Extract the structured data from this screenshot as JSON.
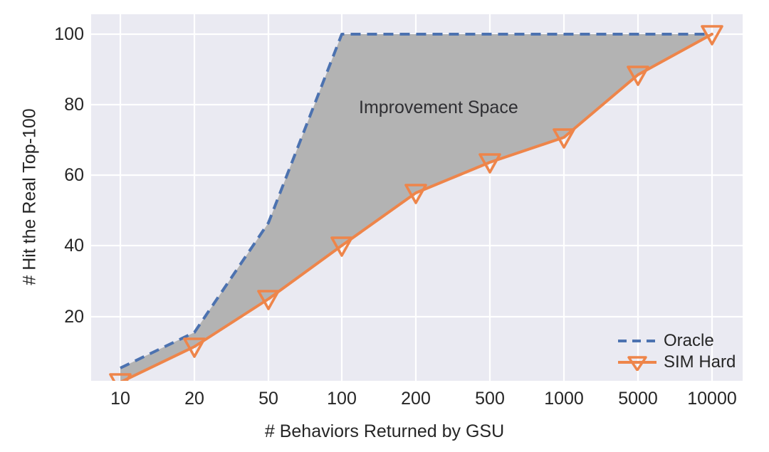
{
  "chart_data": {
    "type": "line",
    "title": "",
    "xlabel": "# Behaviors Returned by GSU",
    "ylabel": "# Hit the Real Top-100",
    "categories": [
      "10",
      "20",
      "50",
      "100",
      "200",
      "500",
      "1000",
      "5000",
      "10000"
    ],
    "xtick_labels": [
      "10",
      "20",
      "50",
      "100",
      "200",
      "500",
      "1000",
      "5000",
      "10000"
    ],
    "ytick_labels": [
      "20",
      "40",
      "60",
      "80",
      "100"
    ],
    "yticks": [
      20,
      40,
      60,
      80,
      100
    ],
    "ylim": [
      4,
      104
    ],
    "grid": true,
    "legend_position": "lower right",
    "series": [
      {
        "name": "Oracle",
        "color": "#4c72b0",
        "linestyle": "dashed",
        "marker": "none",
        "values": [
          10,
          20,
          51,
          100,
          100,
          100,
          100,
          100,
          100
        ]
      },
      {
        "name": "SIM Hard",
        "color": "#ee854a",
        "linestyle": "solid",
        "marker": "triangle-down",
        "values": [
          6,
          11.5,
          25,
          40.5,
          55.5,
          64,
          71,
          88.5,
          100
        ]
      }
    ],
    "annotations": [
      {
        "text": "Improvement Space",
        "x_category": "100",
        "y_value": 81,
        "color": "#2f2f33"
      }
    ],
    "fill_between": {
      "label": "Improvement Space",
      "upper_series": "Oracle",
      "lower_series": "SIM Hard",
      "color": "#b3b3b3",
      "opacity": 1
    },
    "colors": {
      "panel_background": "#eaeaf2",
      "figure_background": "#ffffff",
      "gridline": "#ffffff",
      "tick_text": "#262626",
      "oracle": "#4c72b0",
      "sim_hard": "#ee854a",
      "improvement_fill": "#b3b3b3"
    }
  },
  "legend": {
    "items": [
      {
        "label": "Oracle",
        "color": "#4c72b0",
        "style": "dashed",
        "marker": "none"
      },
      {
        "label": "SIM Hard",
        "color": "#ee854a",
        "style": "solid",
        "marker": "triangle-down"
      }
    ]
  },
  "axes": {
    "y_label": "# Hit the Real Top-100",
    "x_label": "# Behaviors Returned by GSU",
    "y_ticks": [
      "100",
      "80",
      "60",
      "40",
      "20"
    ],
    "x_ticks": [
      "10",
      "20",
      "50",
      "100",
      "200",
      "500",
      "1000",
      "5000",
      "10000"
    ]
  },
  "annotation": {
    "improvement_space": "Improvement Space"
  }
}
